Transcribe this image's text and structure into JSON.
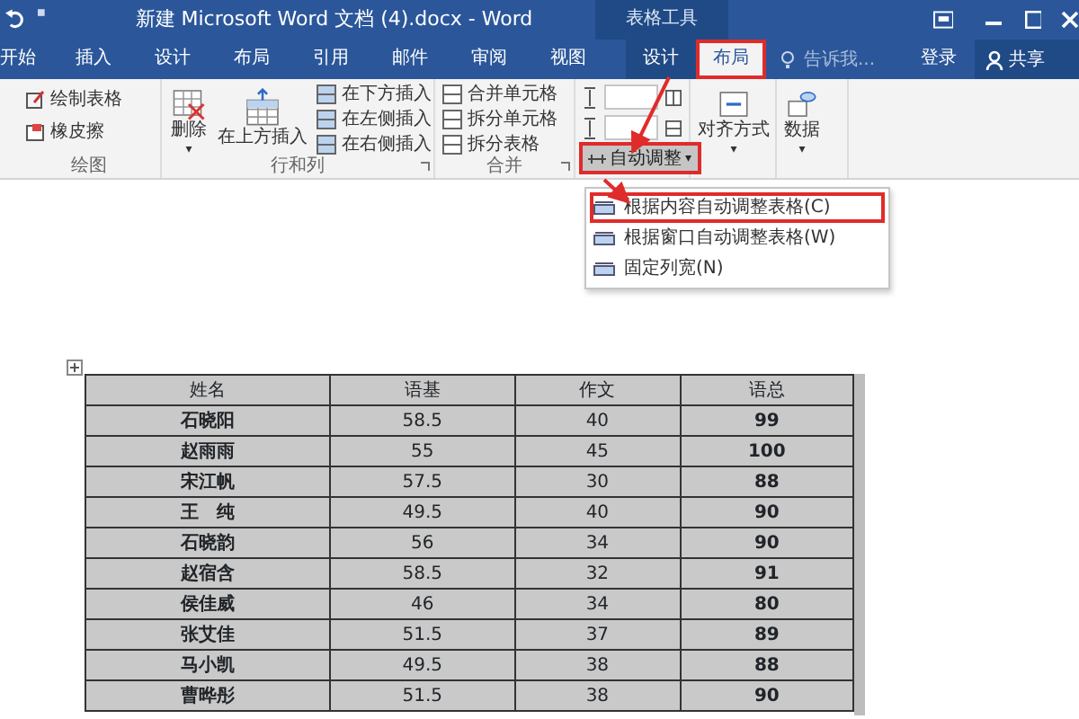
{
  "title_bar": {
    "title": "新建 Microsoft Word 文档 (4).docx - Word"
  },
  "tabs": [
    {
      "label": "开始",
      "selected": false
    },
    {
      "label": "插入",
      "selected": false
    },
    {
      "label": "设计",
      "selected": false
    },
    {
      "label": "布局",
      "selected": false
    },
    {
      "label": "引用",
      "selected": false
    },
    {
      "label": "邮件",
      "selected": false
    },
    {
      "label": "审阅",
      "selected": false
    },
    {
      "label": "视图",
      "selected": false
    }
  ],
  "contextual_tabs": {
    "title": "表格工具",
    "tabs": [
      {
        "label": "设计",
        "selected": false,
        "highlighted": false
      },
      {
        "label": "布局",
        "selected": true,
        "highlighted": true
      }
    ]
  },
  "tell_me": {
    "placeholder": "告诉我..."
  },
  "sign_in": "登录",
  "share": "共享",
  "ribbon": {
    "groups": [
      {
        "label": "绘图",
        "items": [
          {
            "kind": "small",
            "label": "绘制表格"
          },
          {
            "kind": "small",
            "label": "橡皮擦"
          }
        ]
      },
      {
        "label": "行和列",
        "launcher": true,
        "items": [
          {
            "kind": "large",
            "label": "删除",
            "caret": "▾"
          },
          {
            "kind": "large",
            "label": "在上方插入"
          },
          {
            "kind": "stack",
            "items": [
              {
                "label": "在下方插入"
              },
              {
                "label": "在左侧插入"
              },
              {
                "label": "在右侧插入"
              }
            ]
          }
        ]
      },
      {
        "label": "合并",
        "launcher": true,
        "items": [
          {
            "kind": "stack",
            "items": [
              {
                "label": "合并单元格"
              },
              {
                "label": "拆分单元格"
              },
              {
                "label": "拆分表格"
              }
            ]
          }
        ]
      },
      {
        "items": [
          {
            "kind": "size",
            "highlighted": true,
            "dropdown": "自动调整",
            "caret": "▾"
          }
        ]
      },
      {
        "items": [
          {
            "kind": "large",
            "label": "对齐方式",
            "caret": "▾"
          }
        ]
      },
      {
        "items": [
          {
            "kind": "large",
            "label": "数据",
            "caret": "▾"
          }
        ]
      }
    ]
  },
  "autofit_menu": [
    {
      "label": "根据内容自动调整表格(C)",
      "highlighted": true
    },
    {
      "label": "根据窗口自动调整表格(W)",
      "highlighted": false
    },
    {
      "label": "固定列宽(N)",
      "highlighted": false
    }
  ],
  "table": {
    "selected": true,
    "columns": [
      {
        "label": "姓名",
        "bold": true
      },
      {
        "label": "语基",
        "bold": false
      },
      {
        "label": "作文",
        "bold": false
      },
      {
        "label": "语总",
        "bold": true
      }
    ],
    "rows": [
      [
        "石晓阳",
        "58.5",
        "40",
        "99"
      ],
      [
        "赵雨雨",
        "55",
        "45",
        "100"
      ],
      [
        "宋江帆",
        "57.5",
        "30",
        "88"
      ],
      [
        "王　纯",
        "49.5",
        "40",
        "90"
      ],
      [
        "石晓韵",
        "56",
        "34",
        "90"
      ],
      [
        "赵宿含",
        "58.5",
        "32",
        "91"
      ],
      [
        "侯佳威",
        "46",
        "34",
        "80"
      ],
      [
        "张艾佳",
        "51.5",
        "37",
        "89"
      ],
      [
        "马小凯",
        "49.5",
        "38",
        "88"
      ],
      [
        "曹晔彤",
        "51.5",
        "38",
        "90"
      ]
    ]
  }
}
